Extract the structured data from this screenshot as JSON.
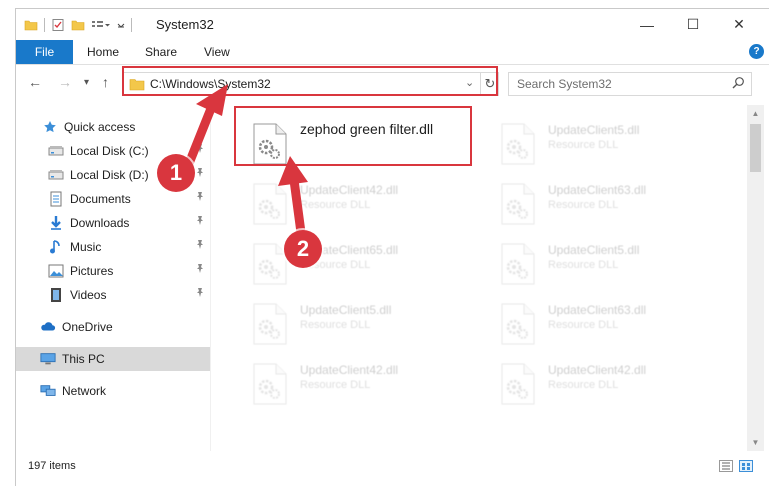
{
  "window": {
    "title": "System32",
    "minimize": "—",
    "maximize": "☐",
    "close": "✕"
  },
  "ribbon": {
    "tabs": [
      "File",
      "Home",
      "Share",
      "View"
    ],
    "help": "?"
  },
  "nav": {
    "back": "←",
    "forward": "→",
    "recent": "▾",
    "up": "↑",
    "address": "C:\\Windows\\System32",
    "address_dropdown": "⌄",
    "refresh": "↻",
    "search_placeholder": "Search System32"
  },
  "sidebar": {
    "items": [
      {
        "label": "Quick access",
        "icon": "star-icon",
        "pinned": false
      },
      {
        "label": "Local Disk (C:)",
        "icon": "drive-icon",
        "pinned": true
      },
      {
        "label": "Local Disk (D:)",
        "icon": "drive-icon",
        "pinned": true
      },
      {
        "label": "Documents",
        "icon": "documents-icon",
        "pinned": true
      },
      {
        "label": "Downloads",
        "icon": "download-icon",
        "pinned": true
      },
      {
        "label": "Music",
        "icon": "music-icon",
        "pinned": true
      },
      {
        "label": "Pictures",
        "icon": "pictures-icon",
        "pinned": true
      },
      {
        "label": "Videos",
        "icon": "videos-icon",
        "pinned": true
      },
      {
        "label": "OneDrive",
        "icon": "cloud-icon",
        "pinned": false
      },
      {
        "label": "This PC",
        "icon": "computer-icon",
        "pinned": false,
        "selected": true
      },
      {
        "label": "Network",
        "icon": "network-icon",
        "pinned": false
      }
    ]
  },
  "files": {
    "main": {
      "name": "zephod green filter.dll"
    },
    "items": [
      {
        "name": "UpdateClient5.dll",
        "type": "Resource DLL"
      },
      {
        "name": "UpdateClient42.dll",
        "type": "Resource DLL"
      },
      {
        "name": "UpdateClient63.dll",
        "type": "Resource DLL"
      },
      {
        "name": "UpdateClient65.dll",
        "type": "Resource DLL"
      },
      {
        "name": "UpdateClient5.dll",
        "type": "Resource DLL"
      },
      {
        "name": "UpdateClient5.dll",
        "type": "Resource DLL"
      },
      {
        "name": "UpdateClient63.dll",
        "type": "Resource DLL"
      },
      {
        "name": "UpdateClient42.dll",
        "type": "Resource DLL"
      },
      {
        "name": "UpdateClient42.dll",
        "type": "Resource DLL"
      }
    ]
  },
  "status": {
    "item_count": "197 items"
  },
  "annotations": {
    "step1": "1",
    "step2": "2"
  },
  "colors": {
    "accent": "#1979ca",
    "highlight": "#d9363e",
    "selected": "#d9d9d9"
  }
}
